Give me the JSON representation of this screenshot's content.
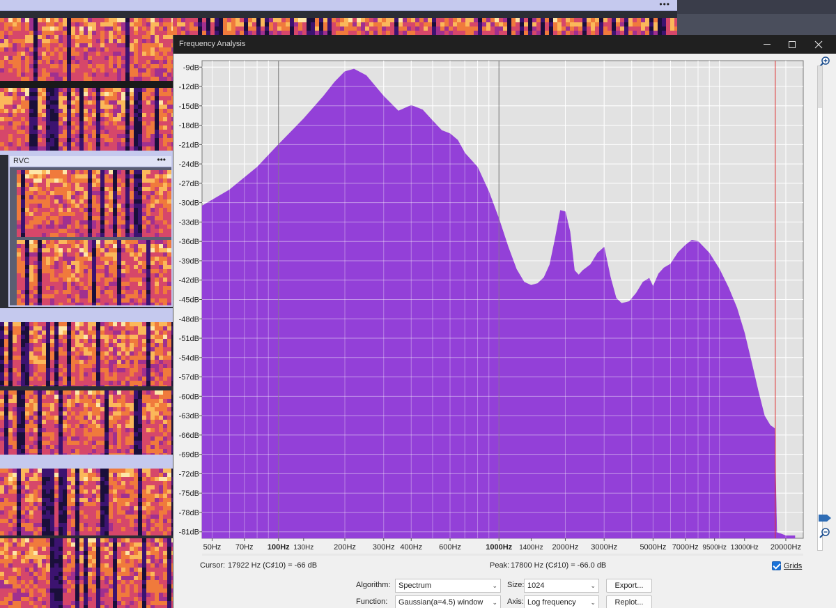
{
  "background": {
    "track_label": "RVC",
    "menu_glyph": "•••"
  },
  "window": {
    "title": "Frequency Analysis",
    "minimize_icon": "minimize-icon",
    "maximize_icon": "maximize-icon",
    "close_icon": "close-icon"
  },
  "chart_data": {
    "type": "area",
    "x_scale": "log",
    "xlim": [
      45,
      24000
    ],
    "ylim": [
      -82,
      -8
    ],
    "grid": true,
    "fill_color": "#9340d8",
    "cursor_line_color": "#e03030",
    "cursor_hz": 17922,
    "y_ticks": [
      -9,
      -12,
      -15,
      -18,
      -21,
      -24,
      -27,
      -30,
      -33,
      -36,
      -39,
      -42,
      -45,
      -48,
      -51,
      -54,
      -57,
      -60,
      -63,
      -66,
      -69,
      -72,
      -75,
      -78,
      -81
    ],
    "y_tick_labels": [
      "-9dB",
      "-12dB",
      "-15dB",
      "-18dB",
      "-21dB",
      "-24dB",
      "-27dB",
      "-30dB",
      "-33dB",
      "-36dB",
      "-39dB",
      "-42dB",
      "-45dB",
      "-48dB",
      "-51dB",
      "-54dB",
      "-57dB",
      "-60dB",
      "-63dB",
      "-66dB",
      "-69dB",
      "-72dB",
      "-75dB",
      "-78dB",
      "-81dB"
    ],
    "x_ticks": [
      50,
      70,
      100,
      130,
      200,
      300,
      400,
      600,
      1000,
      1400,
      2000,
      3000,
      5000,
      7000,
      9500,
      13000,
      20000
    ],
    "x_tick_labels": [
      "50Hz",
      "70Hz",
      "100Hz",
      "130Hz",
      "200Hz",
      "300Hz",
      "400Hz",
      "600Hz",
      "1000Hz",
      "1400Hz",
      "2000Hz",
      "3000Hz",
      "5000Hz",
      "7000Hz",
      "9500Hz",
      "13000Hz",
      "20000Hz"
    ],
    "major_x_ticks": [
      100,
      1000
    ],
    "spectrum": {
      "x": [
        45,
        60,
        80,
        100,
        130,
        160,
        180,
        200,
        220,
        250,
        300,
        350,
        400,
        450,
        500,
        550,
        600,
        650,
        700,
        800,
        900,
        1000,
        1100,
        1200,
        1300,
        1400,
        1500,
        1600,
        1700,
        1800,
        1900,
        2000,
        2100,
        2200,
        2300,
        2400,
        2600,
        2800,
        3000,
        3200,
        3400,
        3600,
        3900,
        4200,
        4500,
        4800,
        5000,
        5300,
        5600,
        6000,
        6500,
        7000,
        7500,
        8000,
        9000,
        10000,
        11000,
        12000,
        13000,
        14000,
        15000,
        16000,
        17000,
        17500,
        17800,
        18200,
        19000,
        20000,
        22000
      ],
      "y": [
        -30.5,
        -28,
        -24.5,
        -21,
        -17,
        -13.5,
        -11.3,
        -9.7,
        -9.3,
        -10.3,
        -13.5,
        -15.8,
        -14.9,
        -15.6,
        -17.3,
        -18.8,
        -19.3,
        -20.3,
        -22.3,
        -24.5,
        -28.3,
        -32.5,
        -36.8,
        -40.3,
        -42.3,
        -42.8,
        -42.5,
        -41.6,
        -39.6,
        -35.5,
        -31.2,
        -31.4,
        -34.5,
        -40.5,
        -41.2,
        -40.5,
        -39.6,
        -37.8,
        -36.9,
        -41.5,
        -44.8,
        -45.6,
        -45.3,
        -44.0,
        -42.3,
        -41.7,
        -43.0,
        -41.0,
        -40.1,
        -39.5,
        -37.7,
        -36.6,
        -35.8,
        -36.0,
        -37.8,
        -40.3,
        -43.2,
        -46.3,
        -50.2,
        -54.8,
        -59.2,
        -63.0,
        -64.5,
        -64.8,
        -65.0,
        -81.1,
        -81.3,
        -81.6,
        -81.6
      ]
    }
  },
  "status": {
    "cursor_label": "Cursor:",
    "cursor_value": "17922 Hz (C♯10) = -66 dB",
    "peak_label": "Peak:",
    "peak_value": "17800 Hz (C♯10) = -66.0 dB",
    "grids_label": "Grids",
    "grids_checked": true
  },
  "controls": {
    "algorithm_label": "Algorithm:",
    "algorithm_value": "Spectrum",
    "size_label": "Size:",
    "size_value": "1024",
    "export_label": "Export...",
    "function_label": "Function:",
    "function_value": "Gaussian(a=4.5) window",
    "axis_label": "Axis:",
    "axis_value": "Log frequency",
    "replot_label": "Replot..."
  }
}
